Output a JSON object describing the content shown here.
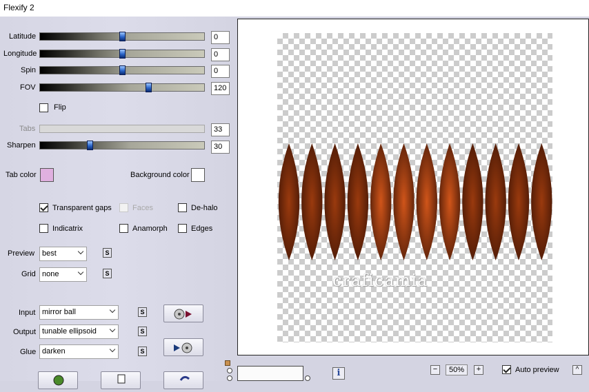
{
  "window": {
    "title": "Flexify 2"
  },
  "sliders": [
    {
      "label": "Latitude",
      "value": "0",
      "level": 0.5
    },
    {
      "label": "Longitude",
      "value": "0",
      "level": 0.5
    },
    {
      "label": "Spin",
      "value": "0",
      "level": 0.5
    },
    {
      "label": "FOV",
      "value": "120",
      "level": 0.67
    },
    {
      "label": "Tabs",
      "value": "33",
      "disabled": true
    },
    {
      "label": "Sharpen",
      "value": "30",
      "level": 0.3
    }
  ],
  "flip": {
    "label": "Flip",
    "checked": false
  },
  "colors": {
    "tab_label": "Tab color",
    "tab_color": "#e0b0e0",
    "bg_label": "Background color",
    "bg_color": "#ffffff",
    "lens_dark": "#3a1204",
    "lens_mid": "#9a3a0e",
    "lens_light": "#d0551a"
  },
  "options": {
    "transparent_gaps": {
      "label": "Transparent gaps",
      "checked": true
    },
    "faces": {
      "label": "Faces",
      "checked": false,
      "disabled": true
    },
    "de_halo": {
      "label": "De-halo",
      "checked": false
    },
    "indicatrix": {
      "label": "Indicatrix",
      "checked": false
    },
    "anamorph": {
      "label": "Anamorph",
      "checked": false
    },
    "edges": {
      "label": "Edges",
      "checked": false
    }
  },
  "preview_select": {
    "label": "Preview",
    "value": "best"
  },
  "grid_select": {
    "label": "Grid",
    "value": "none"
  },
  "input_select": {
    "label": "Input",
    "value": "mirror ball"
  },
  "output_select": {
    "label": "Output",
    "value": "tunable ellipsoid"
  },
  "glue_select": {
    "label": "Glue",
    "value": "darken"
  },
  "s_label": "S",
  "watermark": "craficamia",
  "zoom": {
    "value": "50%",
    "minus": "−",
    "plus": "+"
  },
  "auto_preview": {
    "label": "Auto preview",
    "checked": true
  },
  "info_label": "i",
  "collapse_label": "^",
  "icons": {
    "input_swap": "disc-arrow-icon",
    "output_swap": "arrow-disc-icon",
    "ok": "globe-check-icon",
    "cancel": "hand-stop-icon",
    "reset": "undo-arrow-icon"
  }
}
